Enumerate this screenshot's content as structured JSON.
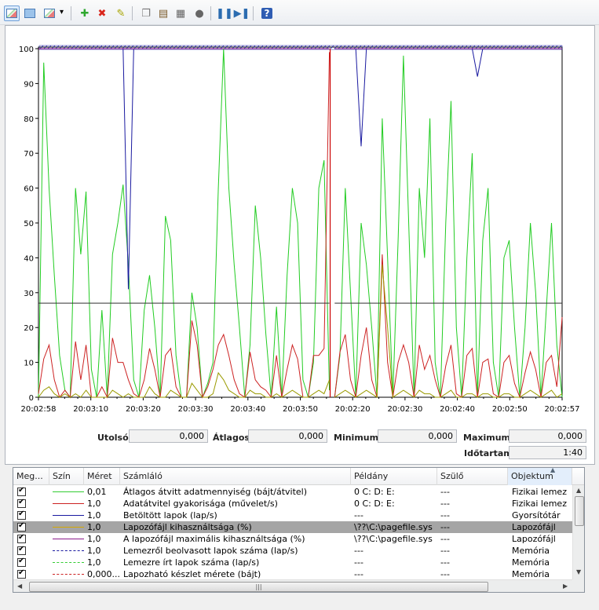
{
  "toolbar": {
    "buttons": [
      {
        "name": "view-graph-icon",
        "glyph": "",
        "color": "#2b6cb0"
      },
      {
        "name": "view-histogram-icon",
        "glyph": "",
        "color": "#2b6cb0"
      },
      {
        "name": "change-graph-type-icon",
        "glyph": "",
        "color": "#2b6cb0"
      },
      {
        "name": "add-counter-icon",
        "glyph": "✚",
        "color": "#2fa82f"
      },
      {
        "name": "delete-counter-icon",
        "glyph": "✖",
        "color": "#d9261c"
      },
      {
        "name": "highlight-icon",
        "glyph": "✎",
        "color": "#a7a400"
      },
      {
        "name": "copy-properties-icon",
        "glyph": "❐",
        "color": "#777777"
      },
      {
        "name": "paste-counter-list-icon",
        "glyph": "▤",
        "color": "#7a5a2a"
      },
      {
        "name": "properties-icon",
        "glyph": "▦",
        "color": "#666666"
      },
      {
        "name": "zoom-icon",
        "glyph": "●",
        "color": "#666666"
      },
      {
        "name": "freeze-display-icon",
        "glyph": "❚❚",
        "color": "#2b6cb0"
      },
      {
        "name": "update-data-icon",
        "glyph": "▶❚",
        "color": "#2b6cb0"
      },
      {
        "name": "help-icon",
        "glyph": "?",
        "color": "#ffffff"
      }
    ]
  },
  "stats": {
    "last_label": "Utolsó",
    "last_value": "0,000",
    "avg_label": "Átlagos",
    "avg_value": "0,000",
    "min_label": "Minimum",
    "min_value": "0,000",
    "max_label": "Maximum",
    "max_value": "0,000",
    "duration_label": "Időtartam",
    "duration_value": "1:40"
  },
  "list": {
    "headers": [
      "Meg...",
      "Szín",
      "Méret",
      "Számláló",
      "Példány",
      "Szülő",
      "Objektum"
    ],
    "rows": [
      {
        "scale": "0,01",
        "counter": "Átlagos átvitt adatmennyiség (bájt/átvitel)",
        "instance": "0 C: D: E:",
        "parent": "---",
        "object": "Fizikai lemez",
        "color": "#33cc33",
        "dash": "solid",
        "selected": false
      },
      {
        "scale": "1,0",
        "counter": "Adatátvitel gyakorisága (művelet/s)",
        "instance": "0 C: D: E:",
        "parent": "---",
        "object": "Fizikai lemez",
        "color": "#cc2222",
        "dash": "solid",
        "selected": false
      },
      {
        "scale": "1,0",
        "counter": "Betöltött lapok (lap/s)",
        "instance": "---",
        "parent": "---",
        "object": "Gyorsítótár",
        "color": "#1a1aa0",
        "dash": "solid",
        "selected": false
      },
      {
        "scale": "1,0",
        "counter": "Lapozófájl kihasználtsága (%)",
        "instance": "\\??\\C:\\pagefile.sys",
        "parent": "---",
        "object": "Lapozófájl",
        "color": "#d6a800",
        "dash": "solid",
        "selected": true
      },
      {
        "scale": "1,0",
        "counter": "A lapozófájl maximális kihasználtsága (%)",
        "instance": "\\??\\C:\\pagefile.sys",
        "parent": "---",
        "object": "Lapozófájl",
        "color": "#8a1a8a",
        "dash": "solid",
        "selected": false
      },
      {
        "scale": "1,0",
        "counter": "Lemezről beolvasott lapok száma (lap/s)",
        "instance": "---",
        "parent": "---",
        "object": "Memória",
        "color": "#1a1aa0",
        "dash": "dashed",
        "selected": false
      },
      {
        "scale": "1,0",
        "counter": "Lemezre írt lapok száma (lap/s)",
        "instance": "---",
        "parent": "---",
        "object": "Memória",
        "color": "#33cc33",
        "dash": "dashed",
        "selected": false
      },
      {
        "scale": "0,000...",
        "counter": "Lapozható készlet mérete (bájt)",
        "instance": "---",
        "parent": "---",
        "object": "Memória",
        "color": "#cc2222",
        "dash": "dashed",
        "selected": false
      }
    ],
    "scroll_grip": "|||"
  },
  "chart_data": {
    "type": "line",
    "ylim": [
      0,
      100
    ],
    "yticks": [
      0,
      10,
      20,
      30,
      40,
      50,
      60,
      70,
      80,
      90,
      100
    ],
    "xtick_labels": [
      "20:02:58",
      "20:03:10",
      "20:03:20",
      "20:03:30",
      "20:03:40",
      "20:03:50",
      "20:02:20",
      "20:02:30",
      "20:02:40",
      "20:02:50",
      "20:02:57"
    ],
    "grid": false,
    "samples": 100,
    "marker_index": 55,
    "series": [
      {
        "color": "#22cc22",
        "values": [
          0,
          96,
          60,
          35,
          12,
          2,
          0,
          60,
          41,
          59,
          8,
          0,
          25,
          0,
          41,
          50,
          61,
          38,
          5,
          0,
          25,
          35,
          20,
          0,
          52,
          45,
          12,
          0,
          0,
          30,
          20,
          0,
          4,
          10,
          60,
          100,
          60,
          38,
          20,
          0,
          15,
          55,
          40,
          18,
          0,
          26,
          0,
          35,
          60,
          50,
          5,
          0,
          10,
          60,
          68,
          2,
          0,
          12,
          60,
          30,
          0,
          50,
          38,
          20,
          0,
          80,
          40,
          0,
          45,
          98,
          50,
          0,
          60,
          40,
          80,
          10,
          0,
          50,
          85,
          20,
          0,
          40,
          70,
          0,
          45,
          60,
          10,
          0,
          40,
          45,
          20,
          0,
          20,
          50,
          30,
          0,
          25,
          50,
          15,
          0
        ]
      },
      {
        "color": "#cc2222",
        "values": [
          1,
          11,
          15,
          5,
          0,
          2,
          0,
          16,
          5,
          15,
          0,
          0,
          3,
          0,
          17,
          10,
          10,
          5,
          1,
          0,
          5,
          14,
          8,
          0,
          12,
          14,
          3,
          0,
          0,
          22,
          15,
          0,
          3,
          8,
          15,
          18,
          12,
          5,
          1,
          0,
          13,
          5,
          3,
          2,
          0,
          12,
          0,
          8,
          15,
          11,
          0,
          0,
          12,
          12,
          14,
          99,
          0,
          13,
          18,
          5,
          0,
          12,
          20,
          5,
          0,
          41,
          10,
          0,
          10,
          15,
          10,
          0,
          15,
          8,
          12,
          5,
          0,
          9,
          15,
          1,
          0,
          12,
          14,
          0,
          10,
          11,
          1,
          0,
          10,
          12,
          4,
          0,
          7,
          13,
          8,
          0,
          10,
          12,
          3,
          23
        ]
      },
      {
        "color": "#1a1aa0",
        "values": [
          100,
          100,
          100,
          100,
          100,
          100,
          100,
          100,
          100,
          100,
          100,
          100,
          100,
          100,
          100,
          100,
          100,
          31,
          100,
          100,
          100,
          100,
          100,
          100,
          100,
          100,
          100,
          100,
          100,
          100,
          100,
          100,
          100,
          100,
          100,
          100,
          100,
          100,
          100,
          100,
          100,
          100,
          100,
          100,
          100,
          100,
          100,
          100,
          100,
          100,
          100,
          100,
          100,
          100,
          100,
          100,
          100,
          100,
          100,
          100,
          100,
          72,
          100,
          100,
          100,
          100,
          100,
          100,
          100,
          100,
          100,
          100,
          100,
          100,
          100,
          100,
          100,
          100,
          100,
          100,
          100,
          100,
          100,
          92,
          100,
          100,
          100,
          100,
          100,
          100,
          100,
          100,
          100,
          100,
          100,
          100,
          100,
          100,
          100,
          100
        ]
      },
      {
        "color": "#303030",
        "values": [
          27,
          27,
          27,
          27,
          27,
          27,
          27,
          27,
          27,
          27,
          27,
          27,
          27,
          27,
          27,
          27,
          27,
          27,
          27,
          27,
          27,
          27,
          27,
          27,
          27,
          27,
          27,
          27,
          27,
          27,
          27,
          27,
          27,
          27,
          27,
          27,
          27,
          27,
          27,
          27,
          27,
          27,
          27,
          27,
          27,
          27,
          27,
          27,
          27,
          27,
          27,
          27,
          27,
          27,
          27,
          27,
          27,
          27,
          27,
          27,
          27,
          27,
          27,
          27,
          27,
          27,
          27,
          27,
          27,
          27,
          27,
          27,
          27,
          27,
          27,
          27,
          27,
          27,
          27,
          27,
          27,
          27,
          27,
          27,
          27,
          27,
          27,
          27,
          27,
          27,
          27,
          27,
          27,
          27,
          27,
          27,
          27,
          27,
          27,
          27
        ]
      },
      {
        "color": "#8a1a8a",
        "values": [
          100,
          100,
          100,
          100,
          100,
          100,
          100,
          100,
          100,
          100,
          100,
          100,
          100,
          100,
          100,
          100,
          100,
          100,
          100,
          100,
          100,
          100,
          100,
          100,
          100,
          100,
          100,
          100,
          100,
          100,
          100,
          100,
          100,
          100,
          100,
          100,
          100,
          100,
          100,
          100,
          100,
          100,
          100,
          100,
          100,
          100,
          100,
          100,
          100,
          100,
          100,
          100,
          100,
          100,
          100,
          100,
          100,
          100,
          100,
          100,
          100,
          100,
          100,
          100,
          100,
          100,
          100,
          100,
          100,
          100,
          100,
          100,
          100,
          100,
          100,
          100,
          100,
          100,
          100,
          100,
          100,
          100,
          100,
          100,
          100,
          100,
          100,
          100,
          100,
          100,
          100,
          100,
          100,
          100,
          100,
          100,
          100,
          100,
          100,
          100
        ]
      },
      {
        "color": "#9a9a00",
        "values": [
          0,
          2,
          3,
          1,
          0,
          1,
          0,
          1,
          0,
          2,
          0,
          0,
          0,
          0,
          2,
          1,
          0,
          1,
          0,
          0,
          0,
          3,
          1,
          0,
          0,
          2,
          1,
          0,
          0,
          4,
          2,
          0,
          0,
          1,
          7,
          5,
          2,
          1,
          0,
          0,
          2,
          1,
          1,
          0,
          0,
          1,
          0,
          1,
          2,
          1,
          0,
          0,
          1,
          2,
          1,
          5,
          0,
          1,
          2,
          1,
          0,
          1,
          2,
          1,
          0,
          38,
          20,
          0,
          1,
          2,
          1,
          0,
          2,
          1,
          1,
          0,
          0,
          1,
          2,
          0,
          0,
          1,
          1,
          0,
          1,
          1,
          0,
          0,
          1,
          1,
          0,
          0,
          1,
          2,
          1,
          0,
          1,
          2,
          0,
          1
        ]
      }
    ]
  }
}
